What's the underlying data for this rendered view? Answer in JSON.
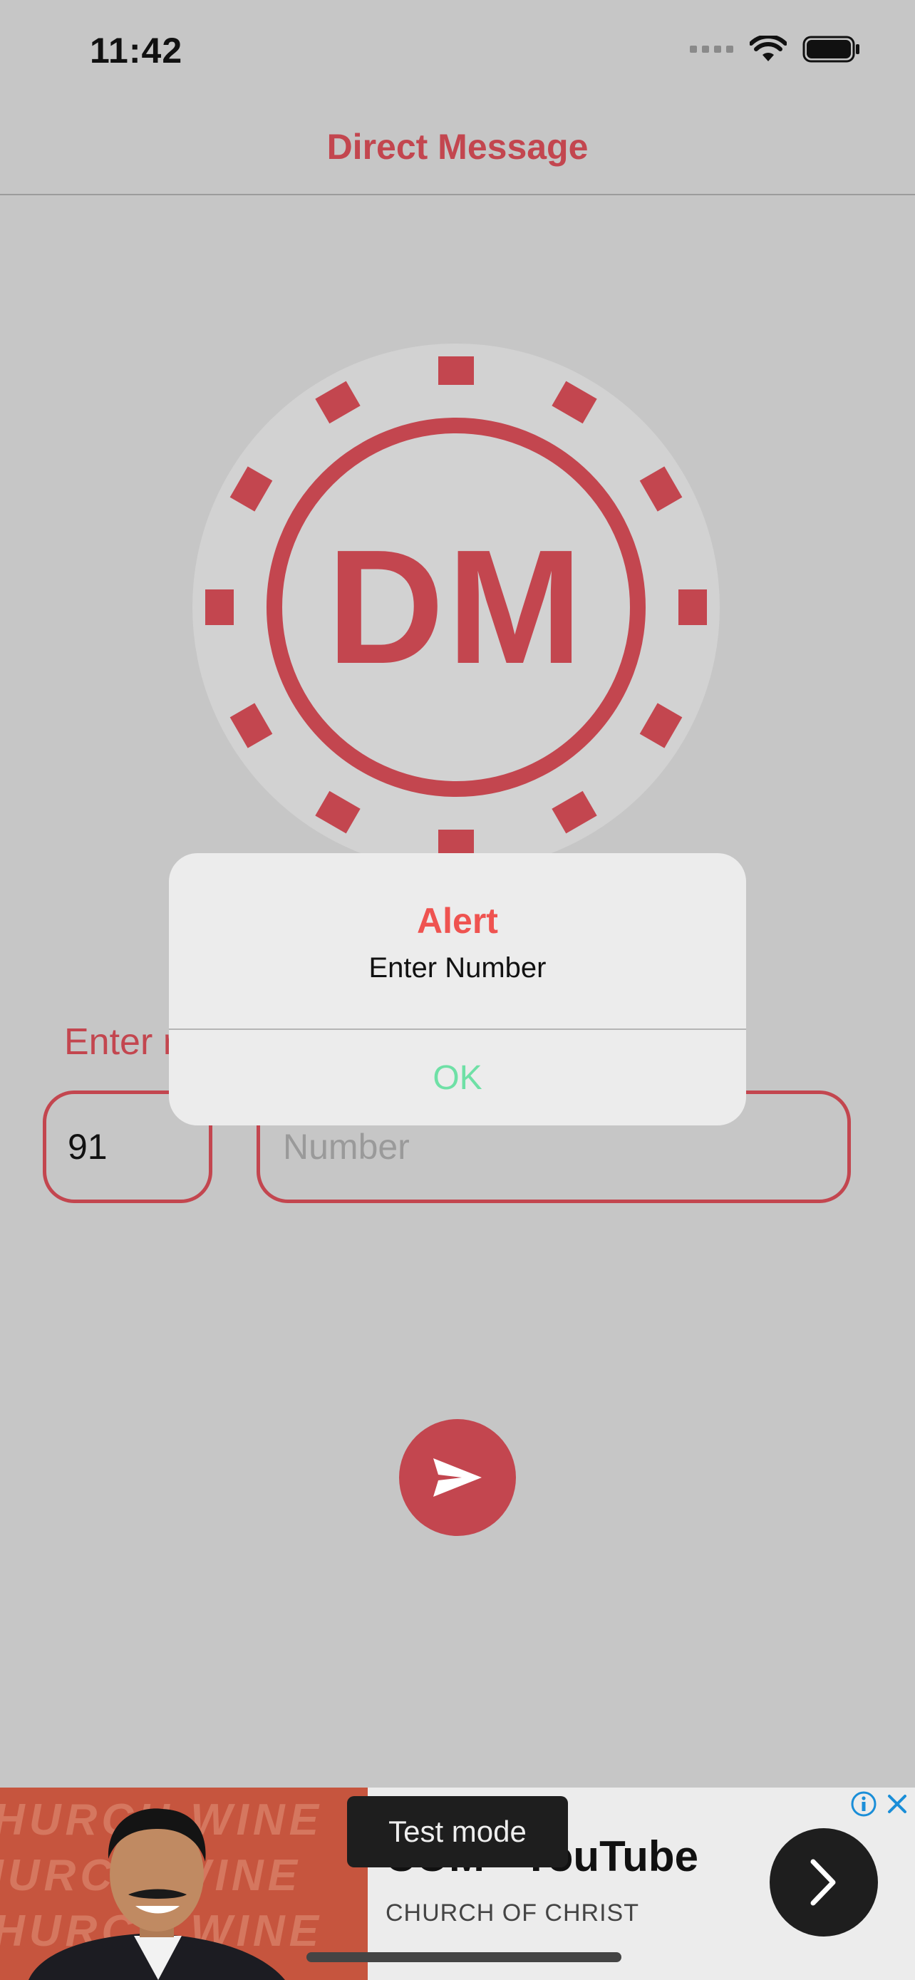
{
  "status_bar": {
    "time": "11:42"
  },
  "navbar": {
    "title": "Direct Message"
  },
  "logo": {
    "text": "DM"
  },
  "form": {
    "label": "Enter r",
    "country_code": "91",
    "number_placeholder": "Number"
  },
  "alert": {
    "title": "Alert",
    "message": "Enter Number",
    "ok_label": "OK"
  },
  "ad": {
    "bg_text": "HURCH WINE",
    "title": "COM - YouTube",
    "subtitle": "CHURCH OF CHRIST",
    "test_mode_label": "Test mode"
  },
  "colors": {
    "accent": "#c3464f",
    "background": "#c6c6c6",
    "alert_title": "#ef5350",
    "alert_ok": "#6fe0a6"
  },
  "icons": [
    "signal-icon",
    "wifi-icon",
    "battery-icon",
    "send-icon",
    "ad-info-icon",
    "ad-close-icon",
    "chevron-right-icon"
  ]
}
